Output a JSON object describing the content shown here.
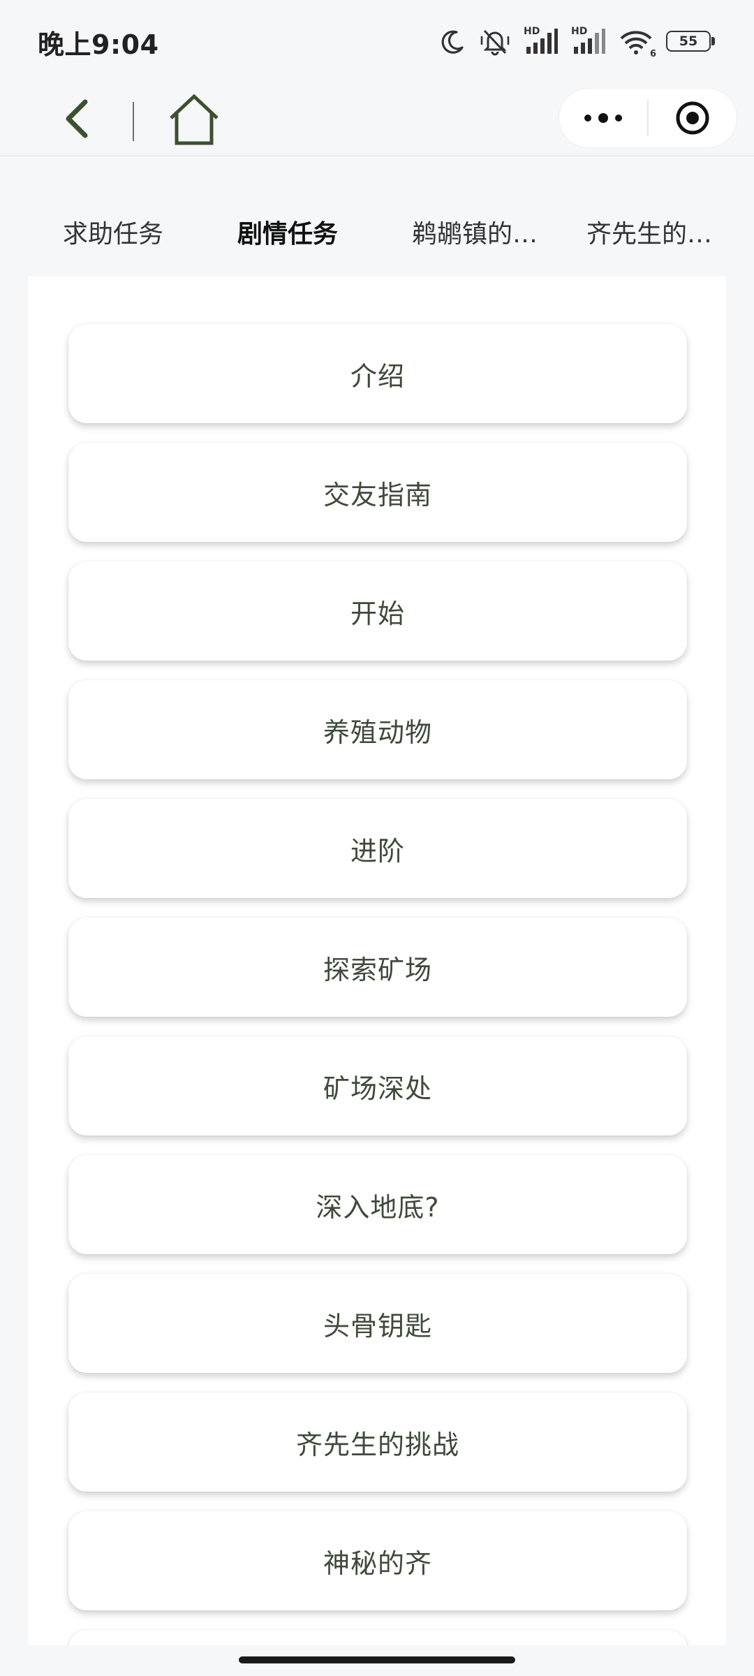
{
  "status_bar": {
    "time": "晚上9:04",
    "battery": "55",
    "network_label_1": "HD",
    "network_label_2": "HD",
    "wifi_badge": "6"
  },
  "nav": {
    "back_icon": "chevron-left-icon",
    "home_icon": "home-icon",
    "more_icon": "more-dots-icon",
    "close_icon": "target-circle-icon",
    "accent_color": "#3d5030"
  },
  "tabs": [
    {
      "label": "求助任务",
      "active": false
    },
    {
      "label": "剧情任务",
      "active": true
    },
    {
      "label": "鹈鹕镇的特殊订单",
      "active": false
    },
    {
      "label": "齐先生的特殊订单",
      "active": false
    }
  ],
  "items": [
    "介绍",
    "交友指南",
    "开始",
    "养殖动物",
    "进阶",
    "探索矿场",
    "矿场深处",
    "深入地底?",
    "头骨钥匙",
    "齐先生的挑战",
    "神秘的齐",
    ""
  ]
}
